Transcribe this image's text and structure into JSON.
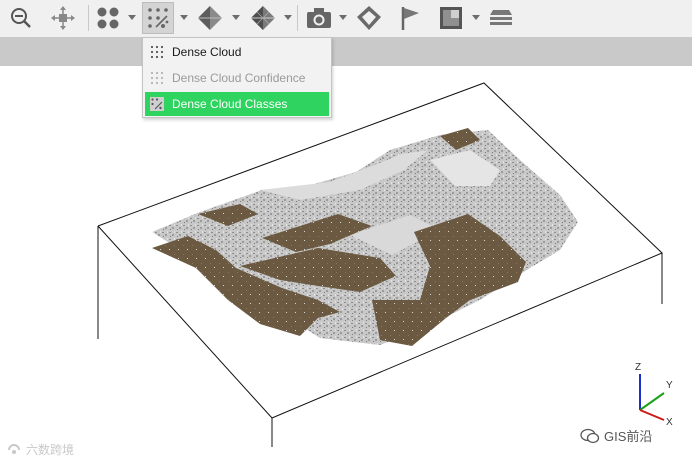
{
  "toolbar": {
    "buttons": [
      {
        "name": "zoom-out",
        "icon": "magnifier-minus-icon"
      },
      {
        "name": "reset-view",
        "icon": "move-arrows-icon"
      },
      {
        "name": "show-points",
        "icon": "four-dots-icon"
      },
      {
        "name": "show-dense-cloud",
        "icon": "dense-dots-icon"
      },
      {
        "name": "show-shaded",
        "icon": "shaded-model-icon"
      },
      {
        "name": "show-textured",
        "icon": "textured-model-icon"
      },
      {
        "name": "show-cameras",
        "icon": "camera-icon"
      },
      {
        "name": "show-shapes",
        "icon": "shape-diamond-icon"
      },
      {
        "name": "show-markers",
        "icon": "flag-icon"
      },
      {
        "name": "show-dem",
        "icon": "dem-image-icon"
      },
      {
        "name": "show-region",
        "icon": "stacked-layers-icon"
      }
    ],
    "accent_color": "#2fd360"
  },
  "menu": {
    "items": [
      {
        "label": "Dense Cloud",
        "state": "normal"
      },
      {
        "label": "Dense Cloud Confidence",
        "state": "disabled"
      },
      {
        "label": "Dense Cloud Classes",
        "state": "selected"
      }
    ]
  },
  "viewport": {
    "ground_color": "#6b5a41",
    "building_color": "#c6c6c6",
    "axes": {
      "z": "Z",
      "y": "Y",
      "x": "X"
    }
  },
  "watermarks": {
    "left": "六数跨境",
    "right": "GIS前沿"
  }
}
